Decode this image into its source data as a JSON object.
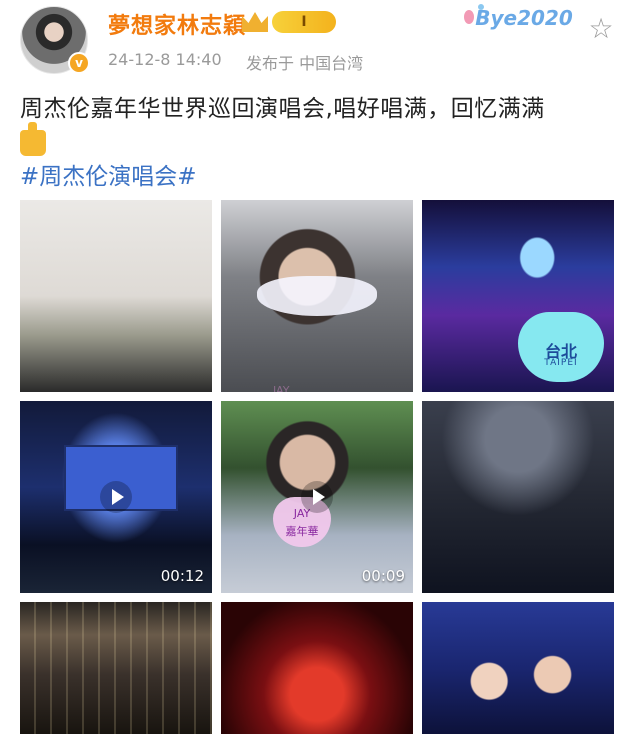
{
  "post": {
    "username": "夢想家林志穎",
    "vip_badge": "I",
    "verified_mark": "v",
    "timestamp": "24-12-8 14:40",
    "location": "发布于 中国台湾",
    "deco_text": "Bye2020",
    "text": "周杰伦嘉年华世界巡回演唱会,唱好唱满，回忆满满",
    "hashtag": "#周杰伦演唱会#",
    "star_icon": "star-icon",
    "emoji_icon": "thumbs-up-icon"
  },
  "media": {
    "items": [
      {
        "label": "",
        "type": "photo"
      },
      {
        "label": "JAY",
        "type": "photo"
      },
      {
        "label": "台北",
        "sub": "TAIPEI",
        "type": "photo"
      },
      {
        "label": "",
        "type": "video",
        "duration": "00:12"
      },
      {
        "label": "JAY",
        "sub": "嘉年華",
        "type": "video",
        "duration": "00:09"
      },
      {
        "label": "",
        "type": "photo"
      },
      {
        "label": "",
        "type": "photo"
      },
      {
        "label": "",
        "type": "photo"
      },
      {
        "label": "",
        "type": "photo"
      }
    ]
  },
  "colors": {
    "accent": "#f27b0e",
    "link": "#3b72c4",
    "meta": "#9a9a9a"
  }
}
